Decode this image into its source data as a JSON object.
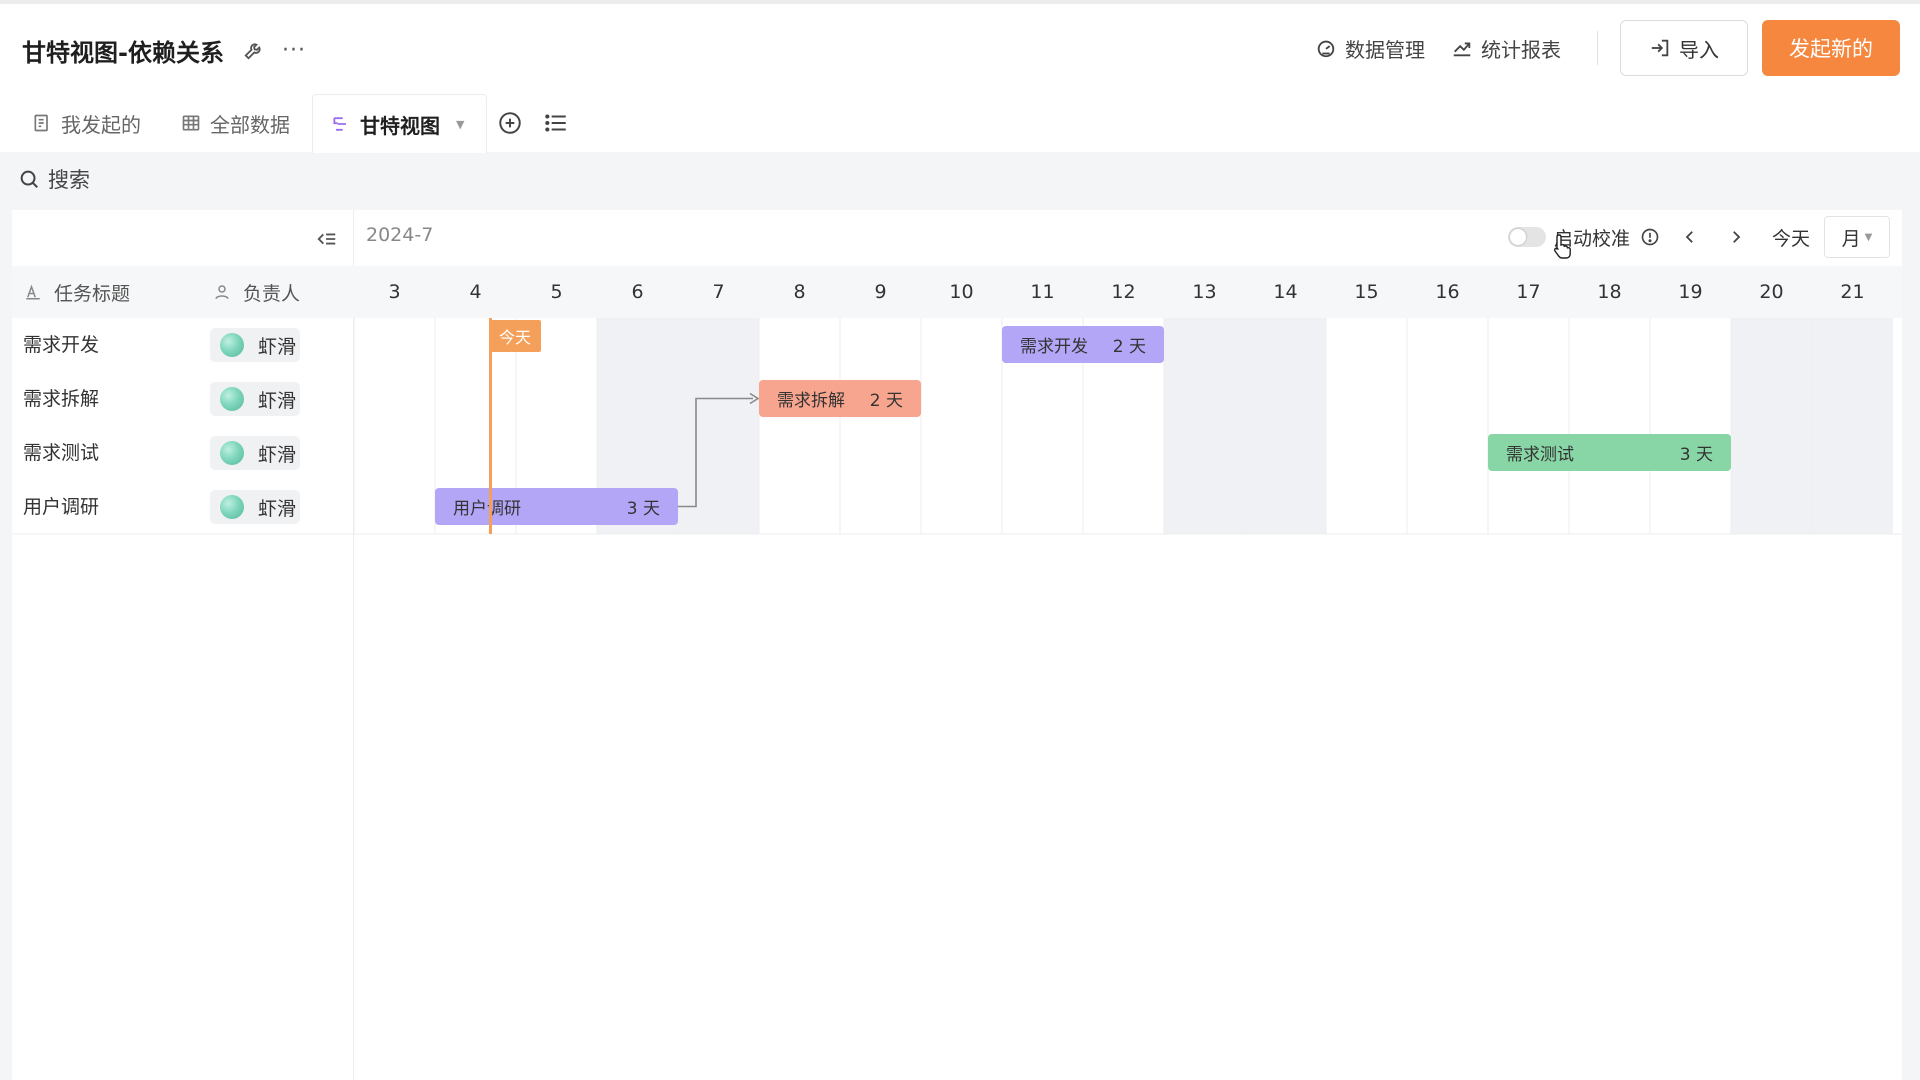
{
  "app": {
    "title": "甘特视图-依赖关系"
  },
  "header": {
    "actions": [
      {
        "label": "数据管理",
        "icon": "dashboard-icon"
      },
      {
        "label": "统计报表",
        "icon": "chart-trend-icon"
      }
    ],
    "import_label": "导入",
    "primary_label": "发起新的",
    "primary_color": "#f5873f"
  },
  "tabs": [
    {
      "label": "我发起的",
      "icon": "form-icon",
      "active": false
    },
    {
      "label": "全部数据",
      "icon": "table-icon",
      "active": false
    },
    {
      "label": "甘特视图",
      "icon": "gantt-icon",
      "active": true
    }
  ],
  "search": {
    "label": "搜索"
  },
  "gantt": {
    "month": "2024-7",
    "columns": {
      "title": "任务标题",
      "owner": "负责人"
    },
    "tasks": [
      {
        "title": "需求开发",
        "owner": "虾滑",
        "start": 11,
        "end": 12,
        "duration": "2 天",
        "color": "#b3a6f7"
      },
      {
        "title": "需求拆解",
        "owner": "虾滑",
        "start": 8,
        "end": 9,
        "duration": "2 天",
        "color": "#f7a58e"
      },
      {
        "title": "需求测试",
        "owner": "虾滑",
        "start": 17,
        "end": 19,
        "duration": "3 天",
        "color": "#88d6a6"
      },
      {
        "title": "用户调研",
        "owner": "虾滑",
        "start": 4,
        "end": 6,
        "duration": "3 天",
        "color": "#b3a6f7"
      }
    ],
    "days": [
      3,
      4,
      5,
      6,
      7,
      8,
      9,
      10,
      11,
      12,
      13,
      14,
      15,
      16,
      17,
      18,
      19,
      20,
      21
    ],
    "weekend_days": [
      6,
      7,
      13,
      14,
      20,
      21
    ],
    "today": 4,
    "today_label": "今天",
    "dependency": {
      "from": "用户调研",
      "to": "需求拆解"
    },
    "controls": {
      "toggle_label": "启动校准",
      "today_label": "今天",
      "scale_label": "月"
    }
  }
}
